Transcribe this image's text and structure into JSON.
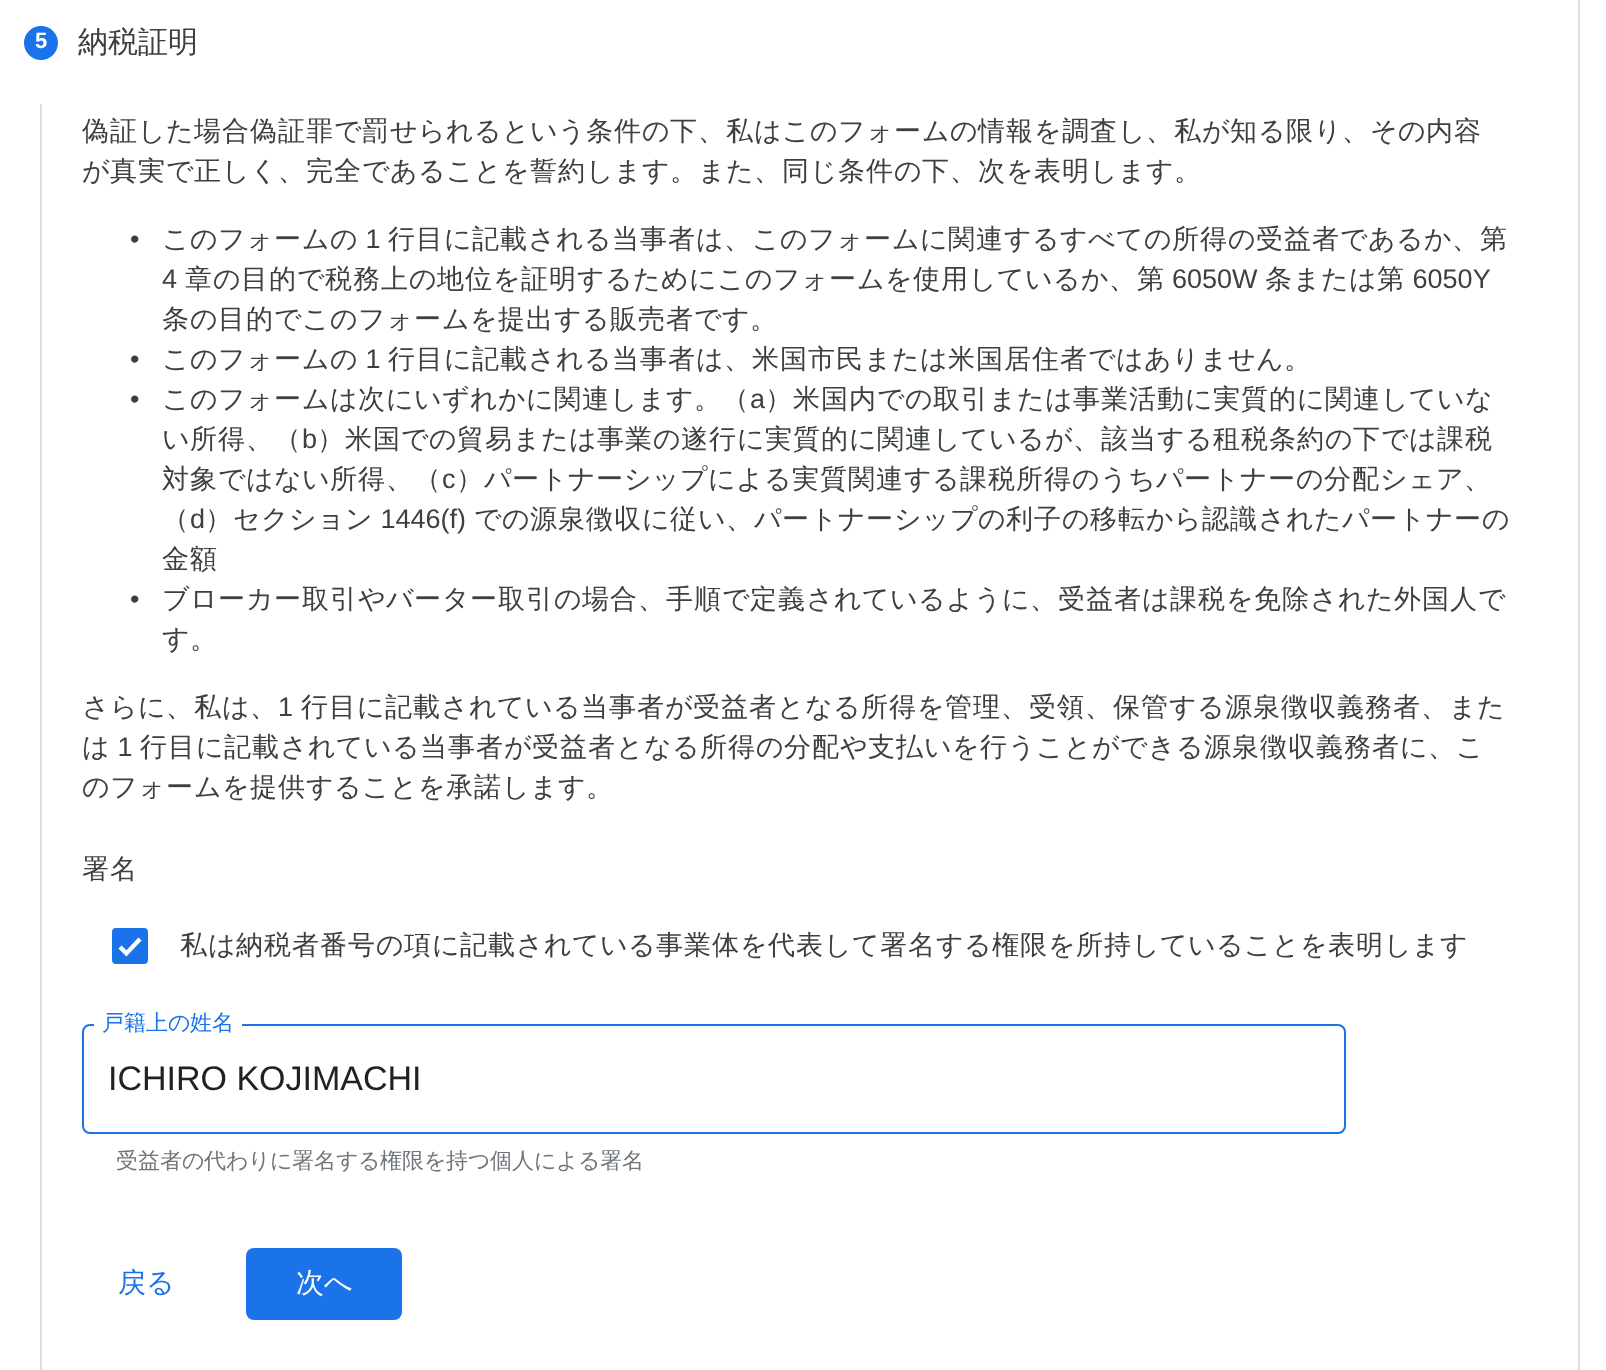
{
  "step": {
    "number": "5",
    "title": "納税証明"
  },
  "intro": "偽証した場合偽証罪で罰せられるという条件の下、私はこのフォームの情報を調査し、私が知る限り、その内容が真実で正しく、完全であることを誓約します。また、同じ条件の下、次を表明します。",
  "bullets": [
    {
      "marker": "•",
      "text": "このフォームの 1 行目に記載される当事者は、このフォームに関連するすべての所得の受益者であるか、第 4 章の目的で税務上の地位を証明するためにこのフォームを使用しているか、第 6050W 条または第 6050Y 条の目的でこのフォームを提出する販売者です。"
    },
    {
      "marker": "•",
      "text": "このフォームの 1 行目に記載される当事者は、米国市民または米国居住者ではありません。"
    },
    {
      "marker": "•",
      "text": "このフォームは次にいずれかに関連します。（a）米国内での取引または事業活動に実質的に関連していない所得、（b）米国での貿易または事業の遂行に実質的に関連しているが、該当する租税条約の下では課税対象ではない所得、（c）パートナーシップによる実質関連する課税所得のうちパートナーの分配シェア、（d）セクション 1446(f) での源泉徴収に従い、パートナーシップの利子の移転から認識されたパートナーの金額"
    },
    {
      "marker": "•",
      "text": "ブローカー取引やバーター取引の場合、手順で定義されているように、受益者は課税を免除された外国人です。"
    }
  ],
  "consent": "さらに、私は、1 行目に記載されている当事者が受益者となる所得を管理、受領、保管する源泉徴収義務者、または 1 行目に記載されている当事者が受益者となる所得の分配や支払いを行うことができる源泉徴収義務者に、このフォームを提供することを承諾します。",
  "signature_heading": "署名",
  "checkbox": {
    "label": "私は納税者番号の項に記載されている事業体を代表して署名する権限を所持していることを表明します",
    "checked": true
  },
  "name_field": {
    "label": "戸籍上の姓名",
    "value": "ICHIRO KOJIMACHI",
    "helper": "受益者の代わりに署名する権限を持つ個人による署名"
  },
  "buttons": [
    {
      "label": "戻る",
      "kind": "text"
    },
    {
      "label": "次へ",
      "kind": "primary"
    }
  ]
}
